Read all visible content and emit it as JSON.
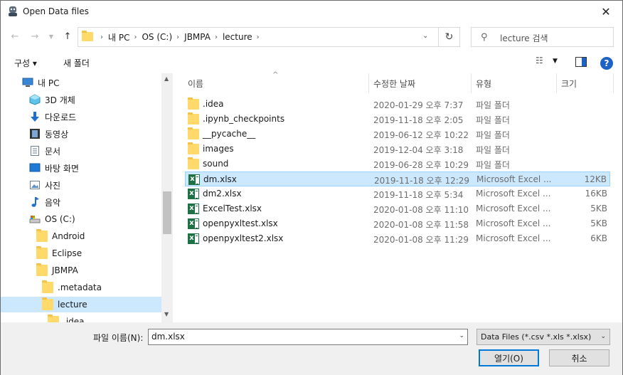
{
  "window": {
    "title": "Open Data files"
  },
  "address": {
    "crumbs": [
      "내 PC",
      "OS (C:)",
      "JBMPA",
      "lecture"
    ]
  },
  "search": {
    "placeholder": "lecture 검색"
  },
  "toolbar": {
    "organize_label": "구성 ▾",
    "new_folder_label": "새 폴더",
    "help_label": "?"
  },
  "nav": {
    "items": [
      {
        "label": "내 PC",
        "icon": "pc-icon",
        "indent": 0
      },
      {
        "label": "3D 개체",
        "icon": "3d-objects-icon",
        "indent": 1
      },
      {
        "label": "다운로드",
        "icon": "download-icon",
        "indent": 1
      },
      {
        "label": "동영상",
        "icon": "video-icon",
        "indent": 1
      },
      {
        "label": "문서",
        "icon": "document-icon",
        "indent": 1
      },
      {
        "label": "바탕 화면",
        "icon": "desktop-icon",
        "indent": 1
      },
      {
        "label": "사진",
        "icon": "picture-icon",
        "indent": 1
      },
      {
        "label": "음악",
        "icon": "music-icon",
        "indent": 1
      },
      {
        "label": "OS (C:)",
        "icon": "drive-icon",
        "indent": 1
      },
      {
        "label": "Android",
        "icon": "folder-icon",
        "indent": 2
      },
      {
        "label": "Eclipse",
        "icon": "folder-icon",
        "indent": 2
      },
      {
        "label": "JBMPA",
        "icon": "folder-icon",
        "indent": 2
      },
      {
        "label": ".metadata",
        "icon": "folder-icon",
        "indent": 3
      },
      {
        "label": "lecture",
        "icon": "folder-icon",
        "indent": 3,
        "selected": true
      },
      {
        "label": ".idea",
        "icon": "folder-icon",
        "indent": 4
      }
    ]
  },
  "columns": {
    "name": "이름",
    "date": "수정한 날짜",
    "type": "유형",
    "size": "크기"
  },
  "files": [
    {
      "name": ".idea",
      "date": "2020-01-29 오후 7:37",
      "type": "파일 폴더",
      "size": "",
      "kind": "folder"
    },
    {
      "name": ".ipynb_checkpoints",
      "date": "2019-11-18 오후 2:05",
      "type": "파일 폴더",
      "size": "",
      "kind": "folder"
    },
    {
      "name": "__pycache__",
      "date": "2019-06-12 오후 10:22",
      "type": "파일 폴더",
      "size": "",
      "kind": "folder"
    },
    {
      "name": "images",
      "date": "2019-12-04 오후 3:18",
      "type": "파일 폴더",
      "size": "",
      "kind": "folder"
    },
    {
      "name": "sound",
      "date": "2019-06-28 오후 10:29",
      "type": "파일 폴더",
      "size": "",
      "kind": "folder"
    },
    {
      "name": "dm.xlsx",
      "date": "2019-11-18 오후 12:29",
      "type": "Microsoft Excel ...",
      "size": "12KB",
      "kind": "xlsx",
      "selected": true
    },
    {
      "name": "dm2.xlsx",
      "date": "2019-11-18 오후 5:34",
      "type": "Microsoft Excel ...",
      "size": "16KB",
      "kind": "xlsx"
    },
    {
      "name": "ExcelTest.xlsx",
      "date": "2020-01-08 오후 11:10",
      "type": "Microsoft Excel ...",
      "size": "5KB",
      "kind": "xlsx"
    },
    {
      "name": "openpyxltest.xlsx",
      "date": "2020-01-08 오후 11:58",
      "type": "Microsoft Excel ...",
      "size": "5KB",
      "kind": "xlsx"
    },
    {
      "name": "openpyxltest2.xlsx",
      "date": "2020-01-08 오후 11:29",
      "type": "Microsoft Excel ...",
      "size": "6KB",
      "kind": "xlsx"
    }
  ],
  "bottom": {
    "filename_label": "파일 이름(N):",
    "filename_value": "dm.xlsx",
    "filter_value": "Data Files (*.csv *.xls *.xlsx)",
    "open_label": "열기(O)",
    "cancel_label": "취소"
  },
  "colors": {
    "selection": "#cce8ff",
    "accent": "#0078d7",
    "folder": "#ffd96a",
    "excel": "#1e7145"
  }
}
